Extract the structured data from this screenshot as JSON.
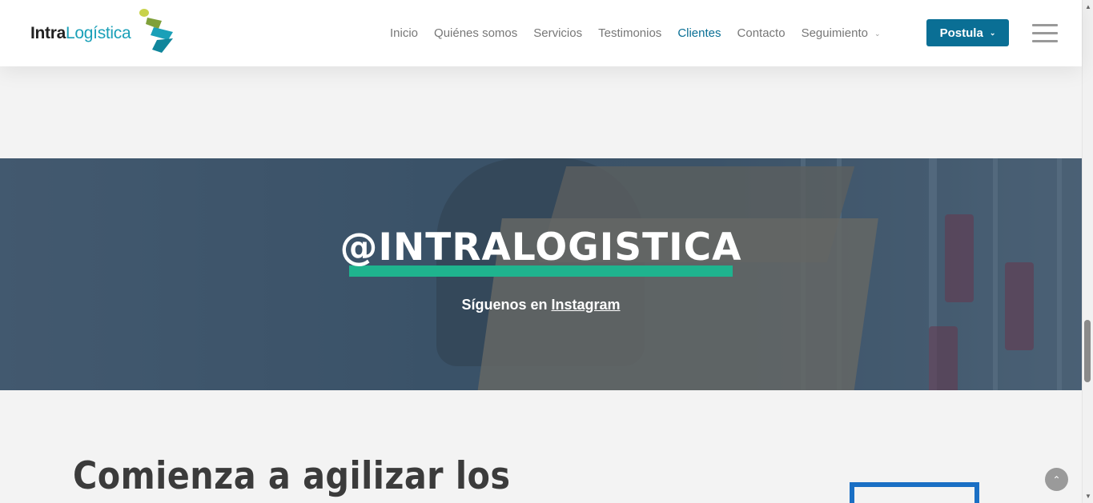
{
  "header": {
    "logo": {
      "bold_text": "Intra",
      "light_text": "Logística"
    },
    "nav": [
      {
        "label": "Inicio",
        "active": false
      },
      {
        "label": "Quiénes somos",
        "active": false
      },
      {
        "label": "Servicios",
        "active": false
      },
      {
        "label": "Testimonios",
        "active": false
      },
      {
        "label": "Clientes",
        "active": true
      },
      {
        "label": "Contacto",
        "active": false
      },
      {
        "label": "Seguimiento",
        "active": false,
        "dropdown": true
      }
    ],
    "cta_label": "Postula",
    "menu_icon": "hamburger-icon"
  },
  "hero": {
    "title": "@INTRALOGISTICA",
    "subtitle_prefix": "Síguenos en ",
    "subtitle_link": "Instagram"
  },
  "section": {
    "heading": "Comienza a agilizar los"
  },
  "colors": {
    "brand_blue": "#0a6f95",
    "accent_green": "#1fb38e",
    "frame_blue": "#1a6fc4"
  }
}
